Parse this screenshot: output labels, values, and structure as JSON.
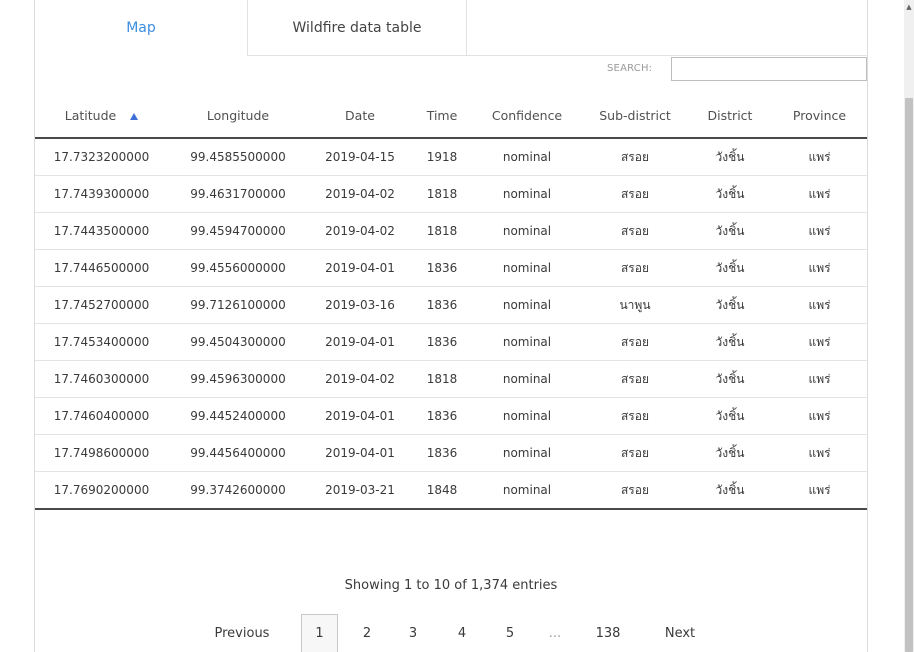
{
  "tabs": {
    "map": "Map",
    "table": "Wildfire data table"
  },
  "search": {
    "label": "SEARCH:",
    "value": ""
  },
  "table": {
    "headers": {
      "latitude": "Latitude",
      "longitude": "Longitude",
      "date": "Date",
      "time": "Time",
      "confidence": "Confidence",
      "subdistrict": "Sub-district",
      "district": "District",
      "province": "Province"
    },
    "rows": [
      {
        "lat": "17.7323200000",
        "lon": "99.4585500000",
        "date": "2019-04-15",
        "time": "1918",
        "conf": "nominal",
        "sub": "สรอย",
        "dist": "วังชิ้น",
        "prov": "แพร่"
      },
      {
        "lat": "17.7439300000",
        "lon": "99.4631700000",
        "date": "2019-04-02",
        "time": "1818",
        "conf": "nominal",
        "sub": "สรอย",
        "dist": "วังชิ้น",
        "prov": "แพร่"
      },
      {
        "lat": "17.7443500000",
        "lon": "99.4594700000",
        "date": "2019-04-02",
        "time": "1818",
        "conf": "nominal",
        "sub": "สรอย",
        "dist": "วังชิ้น",
        "prov": "แพร่"
      },
      {
        "lat": "17.7446500000",
        "lon": "99.4556000000",
        "date": "2019-04-01",
        "time": "1836",
        "conf": "nominal",
        "sub": "สรอย",
        "dist": "วังชิ้น",
        "prov": "แพร่"
      },
      {
        "lat": "17.7452700000",
        "lon": "99.7126100000",
        "date": "2019-03-16",
        "time": "1836",
        "conf": "nominal",
        "sub": "นาพูน",
        "dist": "วังชิ้น",
        "prov": "แพร่"
      },
      {
        "lat": "17.7453400000",
        "lon": "99.4504300000",
        "date": "2019-04-01",
        "time": "1836",
        "conf": "nominal",
        "sub": "สรอย",
        "dist": "วังชิ้น",
        "prov": "แพร่"
      },
      {
        "lat": "17.7460300000",
        "lon": "99.4596300000",
        "date": "2019-04-02",
        "time": "1818",
        "conf": "nominal",
        "sub": "สรอย",
        "dist": "วังชิ้น",
        "prov": "แพร่"
      },
      {
        "lat": "17.7460400000",
        "lon": "99.4452400000",
        "date": "2019-04-01",
        "time": "1836",
        "conf": "nominal",
        "sub": "สรอย",
        "dist": "วังชิ้น",
        "prov": "แพร่"
      },
      {
        "lat": "17.7498600000",
        "lon": "99.4456400000",
        "date": "2019-04-01",
        "time": "1836",
        "conf": "nominal",
        "sub": "สรอย",
        "dist": "วังชิ้น",
        "prov": "แพร่"
      },
      {
        "lat": "17.7690200000",
        "lon": "99.3742600000",
        "date": "2019-03-21",
        "time": "1848",
        "conf": "nominal",
        "sub": "สรอย",
        "dist": "วังชิ้น",
        "prov": "แพร่"
      }
    ]
  },
  "info": "Showing 1 to 10 of 1,374 entries",
  "pagination": {
    "previous": "Previous",
    "pages": [
      "1",
      "2",
      "3",
      "4",
      "5"
    ],
    "ellipsis": "...",
    "last": "138",
    "next": "Next",
    "current": "1"
  }
}
